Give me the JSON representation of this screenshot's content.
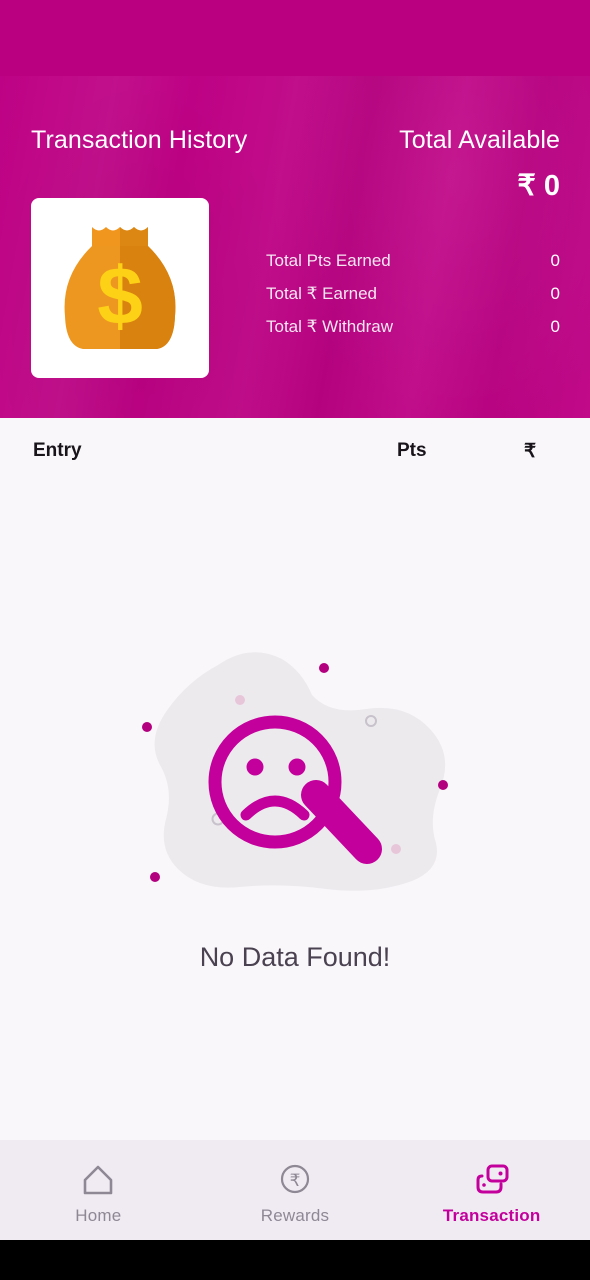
{
  "theme": {
    "brand_pink": "#BE0285",
    "status_pink": "#BA0080",
    "accent_magenta": "#C4009C",
    "content_bg": "#FAF7FB",
    "nav_bg": "#F0EBF3",
    "inactive_gray": "#8E8894",
    "bag_orange_light": "#F0951E",
    "bag_orange_dark": "#D88512",
    "bag_dollar_yellow": "#FCD116",
    "blob_gray": "#EDEAEE"
  },
  "header": {
    "title": "Transaction History",
    "available_label": "Total Available",
    "available_value": "₹ 0",
    "bag_icon": "money-bag-icon",
    "stats": [
      {
        "label": "Total Pts Earned",
        "value": "0"
      },
      {
        "label": "Total ₹ Earned",
        "value": "0"
      },
      {
        "label": "Total ₹ Withdraw",
        "value": "0"
      }
    ]
  },
  "table": {
    "columns": {
      "entry": "Entry",
      "pts": "Pts",
      "rupee": "₹"
    },
    "rows": []
  },
  "empty_state": {
    "illustration": "magnifier-sad-face-icon",
    "message": "No Data Found!"
  },
  "bottom_nav": {
    "items": [
      {
        "label": "Home",
        "icon": "home-icon",
        "active": false
      },
      {
        "label": "Rewards",
        "icon": "rupee-coin-icon",
        "active": false
      },
      {
        "label": "Transaction",
        "icon": "transaction-cards-icon",
        "active": true
      }
    ]
  }
}
